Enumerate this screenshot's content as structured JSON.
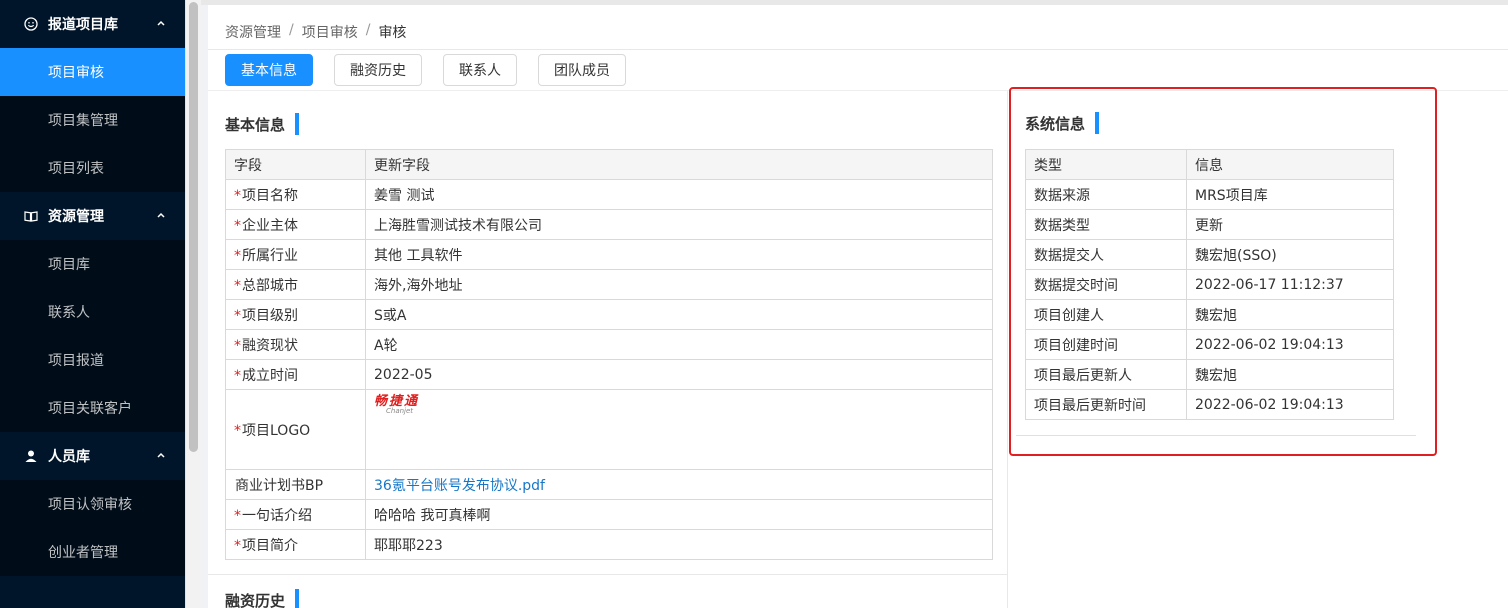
{
  "sidebar": {
    "groups": [
      {
        "label": "报道项目库",
        "items": [
          "项目审核",
          "项目集管理",
          "项目列表"
        ]
      },
      {
        "label": "资源管理",
        "items": [
          "项目库",
          "联系人",
          "项目报道",
          "项目关联客户"
        ]
      },
      {
        "label": "人员库",
        "items": [
          "项目认领审核",
          "创业者管理"
        ]
      }
    ]
  },
  "breadcrumb": [
    "资源管理",
    "项目审核",
    "审核"
  ],
  "breadcrumb_sep": "/",
  "tabs": [
    "基本信息",
    "融资历史",
    "联系人",
    "团队成员"
  ],
  "basic": {
    "title": "基本信息",
    "headers": [
      "字段",
      "更新字段"
    ],
    "rows": [
      {
        "req": "*",
        "field": "项目名称",
        "value": "姜雪 测试"
      },
      {
        "req": "*",
        "field": "企业主体",
        "value": "上海胜雪测试技术有限公司"
      },
      {
        "req": "*",
        "field": "所属行业",
        "value": "其他 工具软件"
      },
      {
        "req": "*",
        "field": "总部城市",
        "value": "海外,海外地址"
      },
      {
        "req": "*",
        "field": "项目级别",
        "value": "S或A"
      },
      {
        "req": "*",
        "field": "融资现状",
        "value": "A轮"
      },
      {
        "req": "*",
        "field": "成立时间",
        "value": "2022-05"
      },
      {
        "req": "*",
        "field": "项目LOGO",
        "logo_cn": "畅捷通",
        "logo_en": "Chanjet"
      },
      {
        "req": "",
        "field": "商业计划书BP",
        "value": "36氪平台账号发布协议.pdf"
      },
      {
        "req": "*",
        "field": "一句话介绍",
        "value": "哈哈哈 我可真棒啊"
      },
      {
        "req": "*",
        "field": "项目简介",
        "value": "耶耶耶223"
      }
    ]
  },
  "financing": {
    "title": "融资历史"
  },
  "system": {
    "title": "系统信息",
    "headers": [
      "类型",
      "信息"
    ],
    "rows": [
      {
        "type": "数据来源",
        "info": "MRS项目库"
      },
      {
        "type": "数据类型",
        "info": "更新"
      },
      {
        "type": "数据提交人",
        "info": "魏宏旭(SSO)"
      },
      {
        "type": "数据提交时间",
        "info": "2022-06-17 11:12:37"
      },
      {
        "type": "项目创建人",
        "info": "魏宏旭"
      },
      {
        "type": "项目创建时间",
        "info": "2022-06-02 19:04:13"
      },
      {
        "type": "项目最后更新人",
        "info": "魏宏旭"
      },
      {
        "type": "项目最后更新时间",
        "info": "2022-06-02 19:04:13"
      }
    ]
  },
  "colors": {
    "accent": "#1890ff",
    "sidebar_bg": "#001529",
    "highlight": "#e02020",
    "required": "#e02020"
  }
}
